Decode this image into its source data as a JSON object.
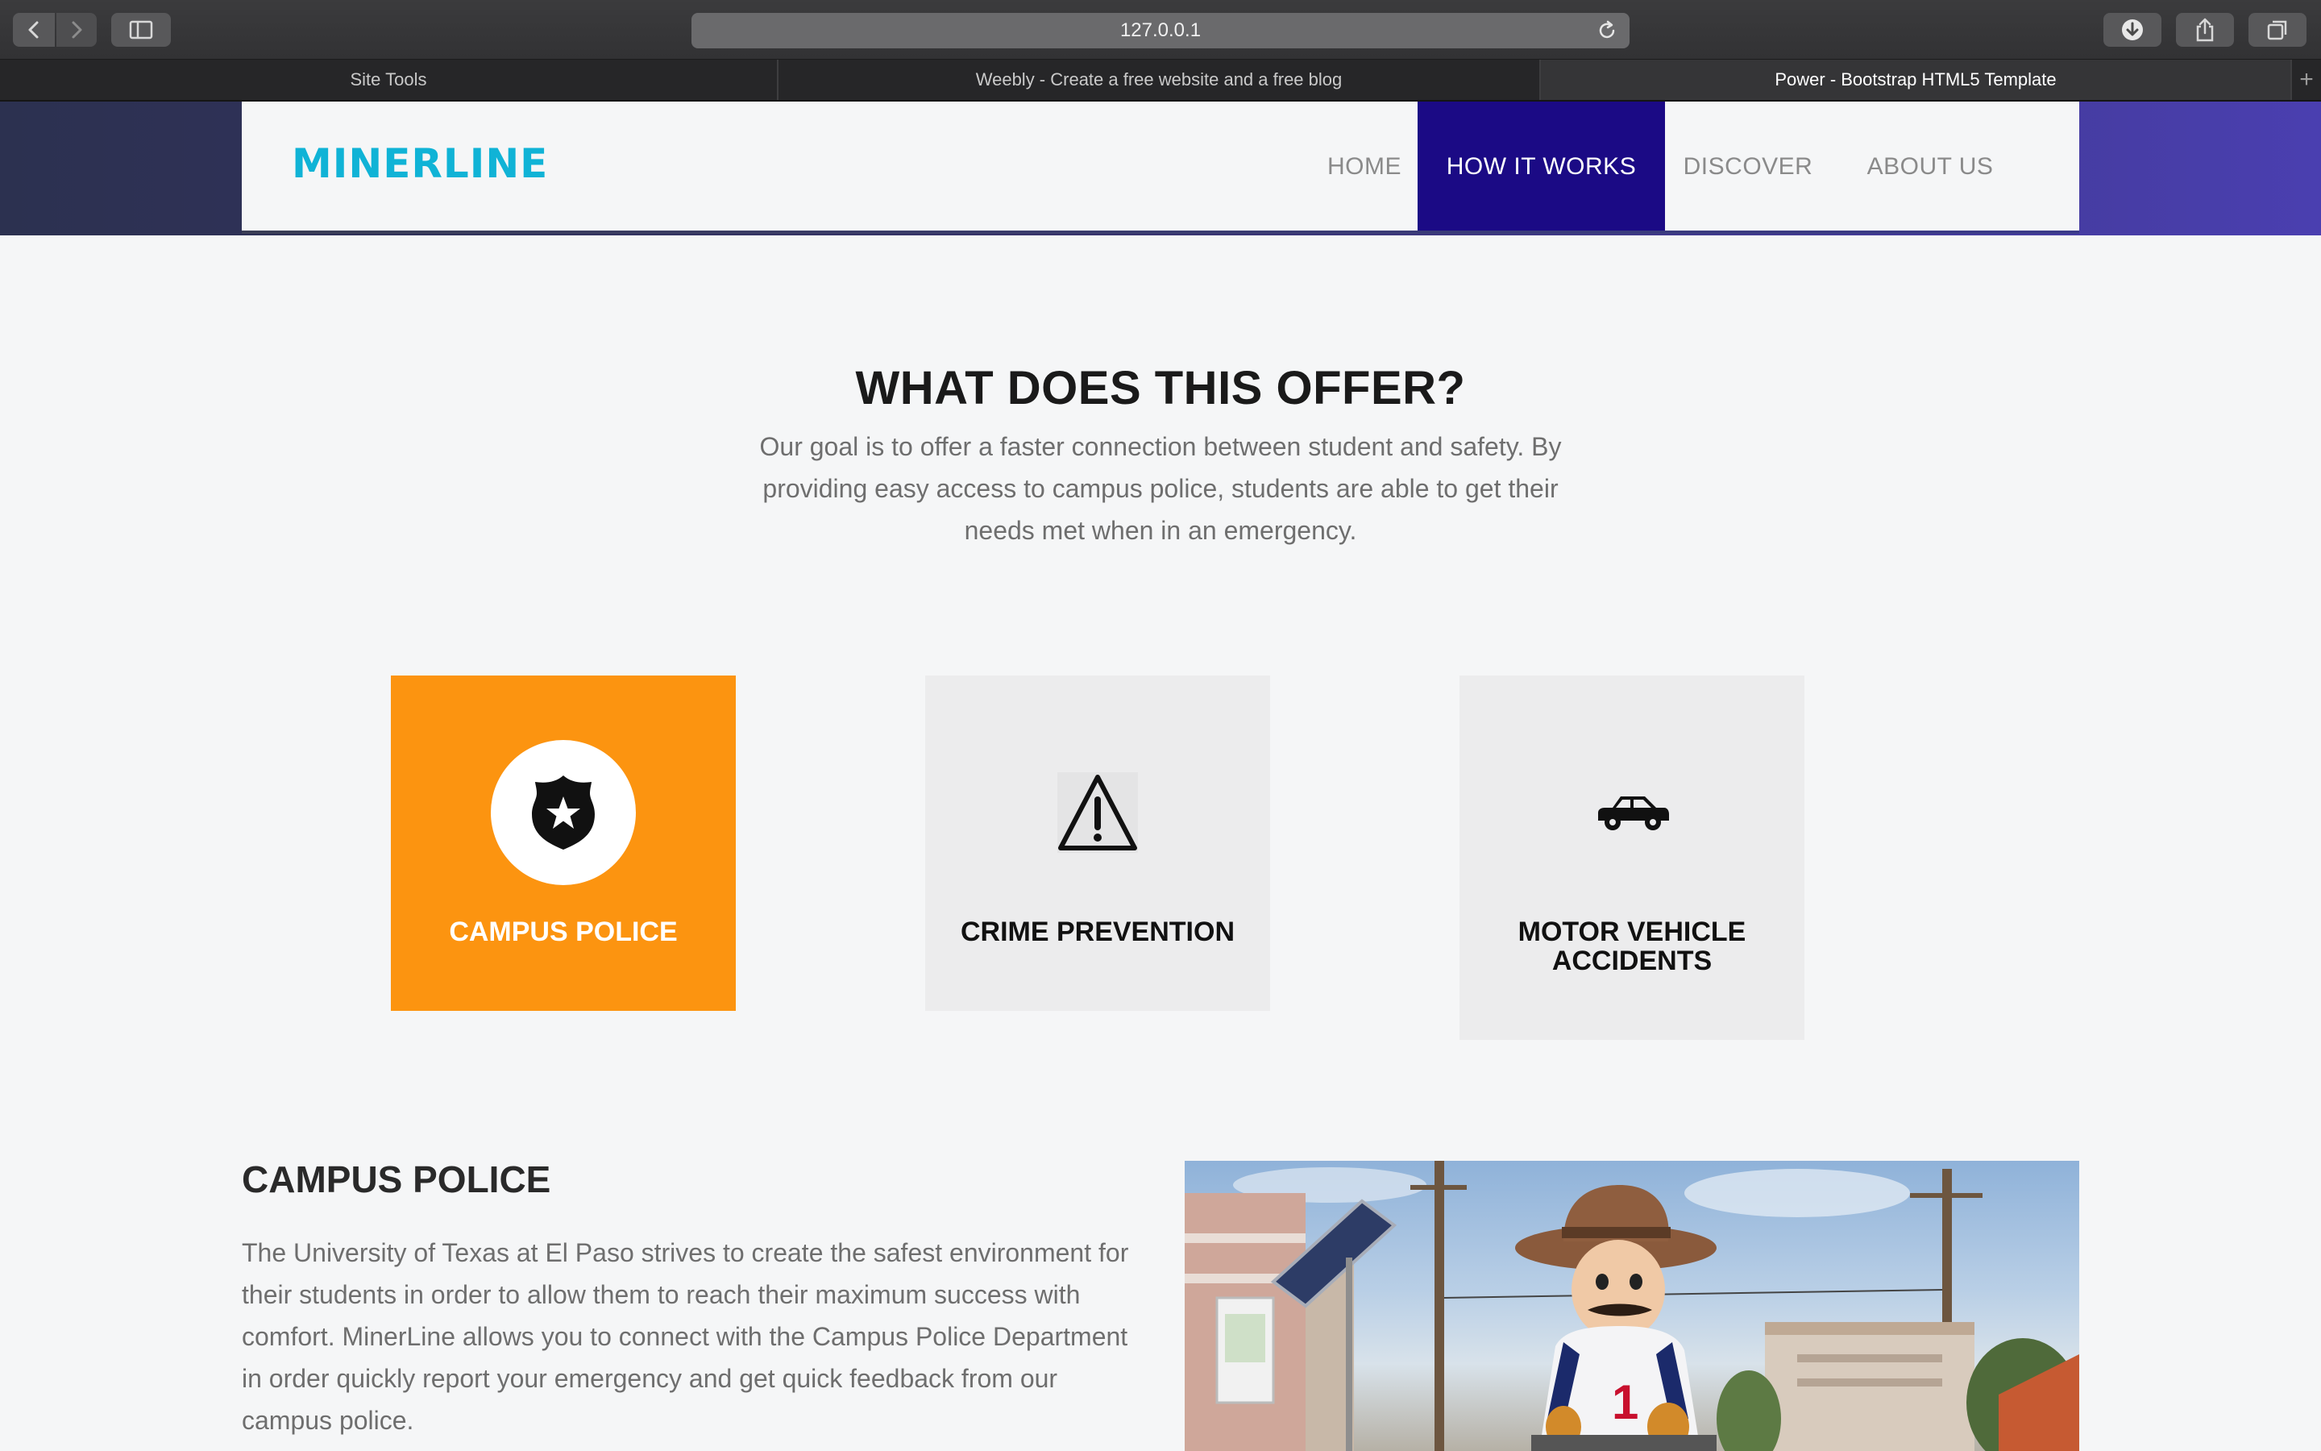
{
  "browser": {
    "url": "127.0.0.1",
    "tabs": [
      {
        "label": "Site Tools",
        "active": false
      },
      {
        "label": "Weebly - Create a free website and a free blog",
        "active": false
      },
      {
        "label": "Power - Bootstrap HTML5 Template",
        "active": true
      }
    ],
    "new_tab_label": "+"
  },
  "site": {
    "brand": "MINERLINE",
    "brand_color": "#10b3d6",
    "nav": [
      {
        "label": "HOME",
        "active": false
      },
      {
        "label": "HOW IT WORKS",
        "active": true
      },
      {
        "label": "DISCOVER",
        "active": false
      },
      {
        "label": "ABOUT US",
        "active": false
      }
    ],
    "nav_active_color": "#1b0a85"
  },
  "offer": {
    "title": "WHAT DOES THIS OFFER?",
    "description": "Our goal is to offer a faster connection between student and safety. By providing easy access to campus police, students are able to get their needs met when in an emergency.",
    "cards": [
      {
        "label": "CAMPUS POLICE",
        "icon": "police-badge-icon",
        "active": true,
        "color": "#fc9410"
      },
      {
        "label": "CRIME PREVENTION",
        "icon": "warning-triangle-icon",
        "active": false
      },
      {
        "label": "MOTOR VEHICLE ACCIDENTS",
        "icon": "car-icon",
        "active": false
      }
    ]
  },
  "campus_police": {
    "title": "CAMPUS POLICE",
    "body": "The University of Texas at El Paso strives to create the safest environment for their students in order to allow them to reach their maximum success with comfort. MinerLine allows you to connect with the Campus Police Department in order quickly report your emergency and get quick feedback from our campus police."
  }
}
